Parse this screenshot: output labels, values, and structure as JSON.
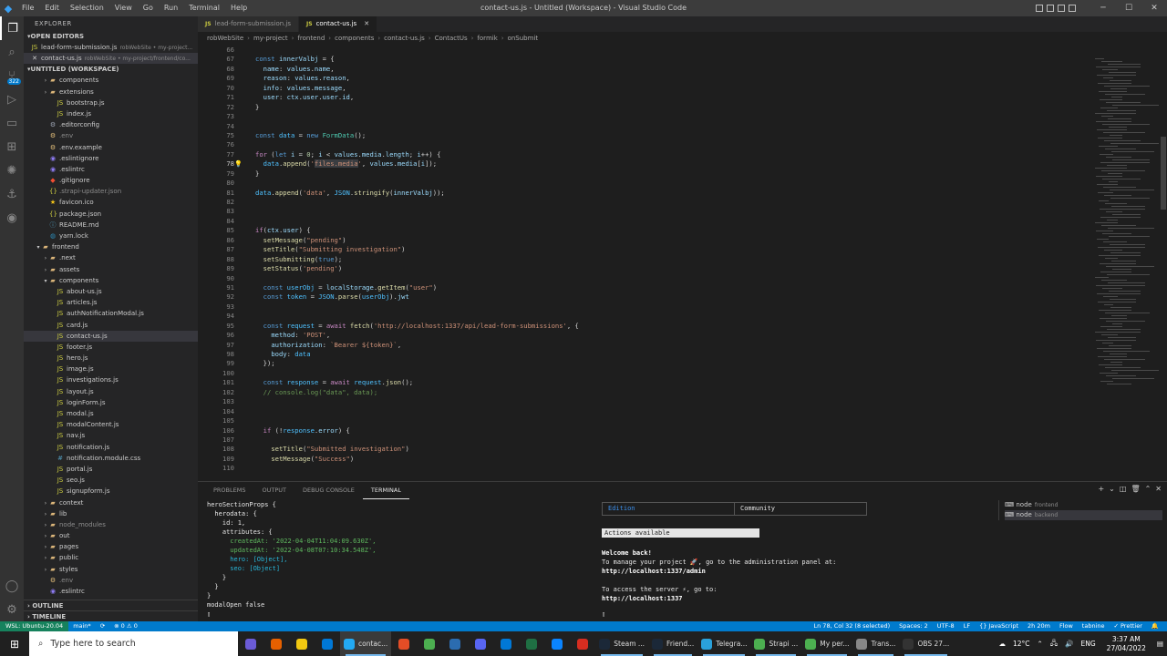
{
  "window": {
    "title": "contact-us.js - Untitled (Workspace) - Visual Studio Code",
    "menu": [
      "File",
      "Edit",
      "Selection",
      "View",
      "Go",
      "Run",
      "Terminal",
      "Help"
    ]
  },
  "sidebar": {
    "header": "EXPLORER",
    "open_editors_label": "OPEN EDITORS",
    "open_editors": [
      {
        "name": "lead-form-submission.js",
        "desc": "robWebSite • my-project..."
      },
      {
        "name": "contact-us.js",
        "desc": "robWebSite • my-project/frontend/co..."
      }
    ],
    "workspace_label": "UNTITLED (WORKSPACE)",
    "tree": [
      {
        "label": "components",
        "indent": 2,
        "kind": "folder"
      },
      {
        "label": "extensions",
        "indent": 2,
        "kind": "folder"
      },
      {
        "label": "bootstrap.js",
        "indent": 3,
        "kind": "js"
      },
      {
        "label": "index.js",
        "indent": 3,
        "kind": "js"
      },
      {
        "label": ".editorconfig",
        "indent": 2,
        "kind": "cfg"
      },
      {
        "label": ".env",
        "indent": 2,
        "kind": "env",
        "dim": true
      },
      {
        "label": ".env.example",
        "indent": 2,
        "kind": "env"
      },
      {
        "label": ".eslintignore",
        "indent": 2,
        "kind": "eslint"
      },
      {
        "label": ".eslintrc",
        "indent": 2,
        "kind": "eslint"
      },
      {
        "label": ".gitignore",
        "indent": 2,
        "kind": "git"
      },
      {
        "label": ".strapi-updater.json",
        "indent": 2,
        "kind": "json",
        "dim": true
      },
      {
        "label": "favicon.ico",
        "indent": 2,
        "kind": "star"
      },
      {
        "label": "package.json",
        "indent": 2,
        "kind": "json"
      },
      {
        "label": "README.md",
        "indent": 2,
        "kind": "info"
      },
      {
        "label": "yarn.lock",
        "indent": 2,
        "kind": "yarn"
      },
      {
        "label": "frontend",
        "indent": 1,
        "kind": "folder",
        "open": true
      },
      {
        "label": ".next",
        "indent": 2,
        "kind": "folder"
      },
      {
        "label": "assets",
        "indent": 2,
        "kind": "folder"
      },
      {
        "label": "components",
        "indent": 2,
        "kind": "folder",
        "open": true
      },
      {
        "label": "about-us.js",
        "indent": 3,
        "kind": "js"
      },
      {
        "label": "articles.js",
        "indent": 3,
        "kind": "js"
      },
      {
        "label": "authNotificationModal.js",
        "indent": 3,
        "kind": "js"
      },
      {
        "label": "card.js",
        "indent": 3,
        "kind": "js"
      },
      {
        "label": "contact-us.js",
        "indent": 3,
        "kind": "js",
        "selected": true
      },
      {
        "label": "footer.js",
        "indent": 3,
        "kind": "js"
      },
      {
        "label": "hero.js",
        "indent": 3,
        "kind": "js"
      },
      {
        "label": "image.js",
        "indent": 3,
        "kind": "js"
      },
      {
        "label": "investigations.js",
        "indent": 3,
        "kind": "js"
      },
      {
        "label": "layout.js",
        "indent": 3,
        "kind": "js"
      },
      {
        "label": "loginForm.js",
        "indent": 3,
        "kind": "js"
      },
      {
        "label": "modal.js",
        "indent": 3,
        "kind": "js"
      },
      {
        "label": "modalContent.js",
        "indent": 3,
        "kind": "js"
      },
      {
        "label": "nav.js",
        "indent": 3,
        "kind": "js"
      },
      {
        "label": "notification.js",
        "indent": 3,
        "kind": "js"
      },
      {
        "label": "notification.module.css",
        "indent": 3,
        "kind": "css"
      },
      {
        "label": "portal.js",
        "indent": 3,
        "kind": "js"
      },
      {
        "label": "seo.js",
        "indent": 3,
        "kind": "js"
      },
      {
        "label": "signupform.js",
        "indent": 3,
        "kind": "js"
      },
      {
        "label": "context",
        "indent": 2,
        "kind": "folder"
      },
      {
        "label": "lib",
        "indent": 2,
        "kind": "folder"
      },
      {
        "label": "node_modules",
        "indent": 2,
        "kind": "folder",
        "dim": true
      },
      {
        "label": "out",
        "indent": 2,
        "kind": "folder"
      },
      {
        "label": "pages",
        "indent": 2,
        "kind": "folder"
      },
      {
        "label": "public",
        "indent": 2,
        "kind": "folder"
      },
      {
        "label": "styles",
        "indent": 2,
        "kind": "folder"
      },
      {
        "label": ".env",
        "indent": 2,
        "kind": "env",
        "dim": true
      },
      {
        "label": ".eslintrc",
        "indent": 2,
        "kind": "eslint"
      }
    ],
    "outline_label": "OUTLINE",
    "timeline_label": "TIMELINE"
  },
  "tabs": [
    {
      "name": "lead-form-submission.js",
      "active": false
    },
    {
      "name": "contact-us.js",
      "active": true
    }
  ],
  "breadcrumb": [
    "robWebSite",
    "my-project",
    "frontend",
    "components",
    "contact-us.js",
    "ContactUs",
    "formik",
    "onSubmit"
  ],
  "code_lines": [
    {
      "n": "66",
      "html": ""
    },
    {
      "n": "67",
      "html": "<span class='k'>const</span> <span class='v'>innerValbj</span> = {"
    },
    {
      "n": "68",
      "html": "  <span class='v'>name</span>: <span class='v'>values</span>.<span class='v'>name</span>,"
    },
    {
      "n": "69",
      "html": "  <span class='v'>reason</span>: <span class='v'>values</span>.<span class='v'>reason</span>,"
    },
    {
      "n": "70",
      "html": "  <span class='v'>info</span>: <span class='v'>values</span>.<span class='v'>message</span>,"
    },
    {
      "n": "71",
      "html": "  <span class='v'>user</span>: <span class='v'>ctx</span>.<span class='v'>user</span>.<span class='v'>user</span>.<span class='v'>id</span>,"
    },
    {
      "n": "72",
      "html": "}"
    },
    {
      "n": "73",
      "html": ""
    },
    {
      "n": "74",
      "html": ""
    },
    {
      "n": "75",
      "html": "<span class='k'>const</span> <span class='cn'>data</span> = <span class='k'>new</span> <span class='cl'>FormData</span>();"
    },
    {
      "n": "76",
      "html": ""
    },
    {
      "n": "77",
      "html": "<span class='kc'>for</span> (<span class='k'>let</span> <span class='v'>i</span> = <span class='n'>0</span>; <span class='v'>i</span> &lt; <span class='v'>values</span>.<span class='v'>media</span>.<span class='v'>length</span>; <span class='v'>i</span>++) {"
    },
    {
      "n": "78",
      "html": "  <span class='cn'>data</span>.<span class='f'>append</span>(<span class='s'>'<span class=\"hl\">files.media</span>'</span>, <span class='v'>values</span>.<span class='v'>media</span>[<span class='v'>i</span>]);",
      "cur": true
    },
    {
      "n": "79",
      "html": "}"
    },
    {
      "n": "80",
      "html": ""
    },
    {
      "n": "81",
      "html": "<span class='cn'>data</span>.<span class='f'>append</span>(<span class='s'>'data'</span>, <span class='cn'>JSON</span>.<span class='f'>stringify</span>(<span class='v'>innerValbj</span>));"
    },
    {
      "n": "82",
      "html": ""
    },
    {
      "n": "83",
      "html": ""
    },
    {
      "n": "84",
      "html": ""
    },
    {
      "n": "85",
      "html": "<span class='kc'>if</span>(<span class='v'>ctx</span>.<span class='v'>user</span>) {"
    },
    {
      "n": "86",
      "html": "  <span class='f'>setMessage</span>(<span class='s'>\"pending\"</span>)"
    },
    {
      "n": "87",
      "html": "  <span class='f'>setTitle</span>(<span class='s'>\"Submitting investigation\"</span>)"
    },
    {
      "n": "88",
      "html": "  <span class='f'>setSubmitting</span>(<span class='k'>true</span>);"
    },
    {
      "n": "89",
      "html": "  <span class='f'>setStatus</span>(<span class='s'>'pending'</span>)"
    },
    {
      "n": "90",
      "html": ""
    },
    {
      "n": "91",
      "html": "  <span class='k'>const</span> <span class='cn'>userObj</span> = <span class='v'>localStorage</span>.<span class='f'>getItem</span>(<span class='s'>\"user\"</span>)"
    },
    {
      "n": "92",
      "html": "  <span class='k'>const</span> <span class='cn'>token</span> = <span class='cn'>JSON</span>.<span class='f'>parse</span>(<span class='cn'>userObj</span>).<span class='v'>jwt</span>"
    },
    {
      "n": "93",
      "html": ""
    },
    {
      "n": "94",
      "html": ""
    },
    {
      "n": "95",
      "html": "  <span class='k'>const</span> <span class='cn'>request</span> = <span class='kc'>await</span> <span class='f'>fetch</span>(<span class='s'>'http://localhost:1337/api/lead-form-submissions'</span>, {"
    },
    {
      "n": "96",
      "html": "    <span class='v'>method</span>: <span class='s'>'POST'</span>,"
    },
    {
      "n": "97",
      "html": "    <span class='v'>authorization</span>: <span class='s'>`Bearer ${token}`</span>,"
    },
    {
      "n": "98",
      "html": "    <span class='v'>body</span>: <span class='cn'>data</span>"
    },
    {
      "n": "99",
      "html": "  });"
    },
    {
      "n": "100",
      "html": ""
    },
    {
      "n": "101",
      "html": "  <span class='k'>const</span> <span class='cn'>response</span> = <span class='kc'>await</span> <span class='cn'>request</span>.<span class='f'>json</span>();"
    },
    {
      "n": "102",
      "html": "  <span class='c'>// console.log(\"data\", data);</span>"
    },
    {
      "n": "103",
      "html": ""
    },
    {
      "n": "104",
      "html": ""
    },
    {
      "n": "105",
      "html": ""
    },
    {
      "n": "106",
      "html": "  <span class='kc'>if</span> (!<span class='cn'>response</span>.<span class='v'>error</span>) {"
    },
    {
      "n": "107",
      "html": ""
    },
    {
      "n": "108",
      "html": "    <span class='f'>setTitle</span>(<span class='s'>\"Submitted investigation\"</span>)"
    },
    {
      "n": "109",
      "html": "    <span class='f'>setMessage</span>(<span class='s'>\"Success\"</span>)"
    },
    {
      "n": "110",
      "html": ""
    }
  ],
  "panel": {
    "tabs": [
      "PROBLEMS",
      "OUTPUT",
      "DEBUG CONSOLE",
      "TERMINAL"
    ],
    "active_tab": "TERMINAL",
    "terminal_left": [
      "heroSectionProps {",
      "  herodata: {",
      "    id: 1,",
      "    attributes: {",
      "      createdAt: '2022-04-04T11:04:09.630Z',",
      "      updatedAt: '2022-04-08T07:10:34.548Z',",
      "      hero: [Object],",
      "      seo: [Object]",
      "    }",
      "  }",
      "}",
      "modalOpen false"
    ],
    "strapi_tabs": [
      "Edition",
      "Community"
    ],
    "actions_available": "Actions available",
    "terminal_right": [
      "Welcome back!",
      "To manage your project 🚀, go to the administration panel at:",
      "http://localhost:1337/admin",
      "",
      "To access the server ⚡, go to:",
      "http://localhost:1337"
    ],
    "terminal_list": [
      {
        "name": "node",
        "desc": "frontend"
      },
      {
        "name": "node",
        "desc": "backend",
        "selected": true
      }
    ]
  },
  "statusbar": {
    "remote": "WSL: Ubuntu-20.04",
    "branch": "main*",
    "sync": "⟳",
    "problems": "⊗ 0 ⚠ 0",
    "position": "Ln 78, Col 32 (8 selected)",
    "spaces": "Spaces: 2",
    "encoding": "UTF-8",
    "eol": "LF",
    "language": "{} JavaScript",
    "time": "2h 20m",
    "flow": "Flow",
    "tabnine": "tabnine",
    "prettier": "✓ Prettier"
  },
  "taskbar": {
    "search_placeholder": "Type here to search",
    "apps": [
      {
        "label": "",
        "color": "#6b5bd6"
      },
      {
        "label": "",
        "color": "#e66000"
      },
      {
        "label": "",
        "color": "#f2c811"
      },
      {
        "label": "",
        "color": "#0078d7"
      },
      {
        "label": "contac...",
        "color": "#23a9f2",
        "active": true
      },
      {
        "label": "",
        "color": "#e44d26"
      },
      {
        "label": "",
        "color": "#4caf50"
      },
      {
        "label": "",
        "color": "#2b6cb0"
      },
      {
        "label": "",
        "color": "#5865f2"
      },
      {
        "label": "",
        "color": "#0078d7"
      },
      {
        "label": "",
        "color": "#1f6f43"
      },
      {
        "label": "",
        "color": "#0a84ff"
      },
      {
        "label": "",
        "color": "#d62d20"
      },
      {
        "label": "Steam ...",
        "color": "#1b2838",
        "running": true
      },
      {
        "label": "Friend...",
        "color": "#1b2838",
        "running": true
      },
      {
        "label": "Telegra...",
        "color": "#2aa1da",
        "running": true
      },
      {
        "label": "Strapi ...",
        "color": "#4caf50",
        "running": true
      },
      {
        "label": "My per...",
        "color": "#4caf50",
        "running": true
      },
      {
        "label": "Trans...",
        "color": "#888888",
        "running": true
      },
      {
        "label": "OBS 27...",
        "color": "#333333",
        "running": true
      }
    ],
    "weather": "12°C",
    "lang": "ENG",
    "time": "3:37 AM",
    "date": "27/04/2022"
  }
}
